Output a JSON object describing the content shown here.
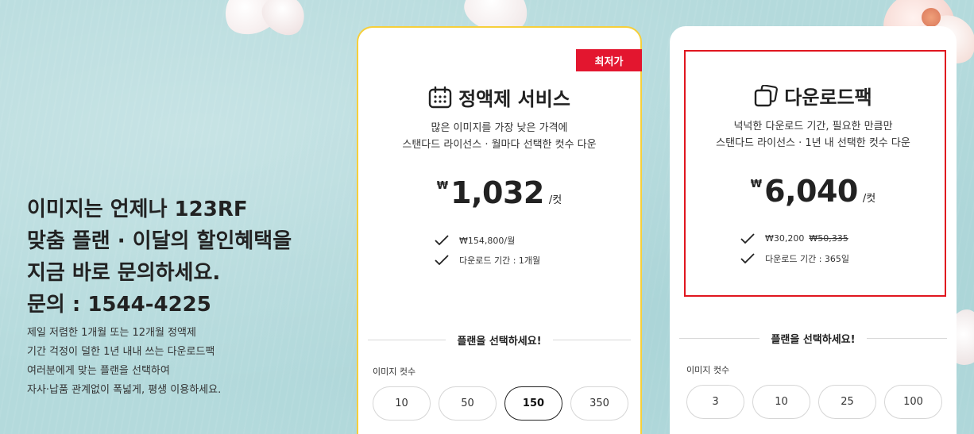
{
  "left": {
    "headline": "이미지는 언제나 123RF\n맞춤 플랜 · 이달의 할인혜택을\n지금 바로 문의하세요.\n문의 : 1544-4225",
    "description": "제일 저렴한 1개월 또는 12개월 정액제\n기간 걱정이 덜한 1년 내내 쓰는 다운로드팩\n여러분에게 맞는 플랜을 선택하여\n자사·납품 관계없이 폭넓게, 평생 이용하세요."
  },
  "subscription": {
    "badge": "최저가",
    "icon": "calendar-icon",
    "title": "정액제 서비스",
    "subtitle": "많은 이미지를 가장 낮은 가격에\n스탠다드 라이선스 · 월마다 선택한 컷수 다운",
    "currency": "₩",
    "price": "1,032",
    "unit": "/컷",
    "feature1": "₩154,800/월",
    "feature2": "다운로드 기간 : 1개월",
    "select_plan": "플랜을 선택하세요!",
    "qty_label": "이미지 컷수",
    "quantities": [
      "10",
      "50",
      "150",
      "350"
    ],
    "selected": "150"
  },
  "download_pack": {
    "icon": "download-pack-icon",
    "title": "다운로드팩",
    "subtitle": "넉넉한 다운로드 기간, 필요한 만큼만\n스탠다드 라이선스 · 1년 내 선택한 컷수 다운",
    "currency": "₩",
    "price": "6,040",
    "unit": "/컷",
    "feature1": "₩30,200",
    "feature1_strike": "₩50,335",
    "feature2": "다운로드 기간 : 365일",
    "select_plan": "플랜을 선택하세요!",
    "qty_label": "이미지 컷수",
    "quantities": [
      "3",
      "10",
      "25",
      "100"
    ]
  },
  "colors": {
    "accent_red": "#e3162f",
    "accent_yellow": "#f6cf3a",
    "background": "#b4dadc"
  }
}
